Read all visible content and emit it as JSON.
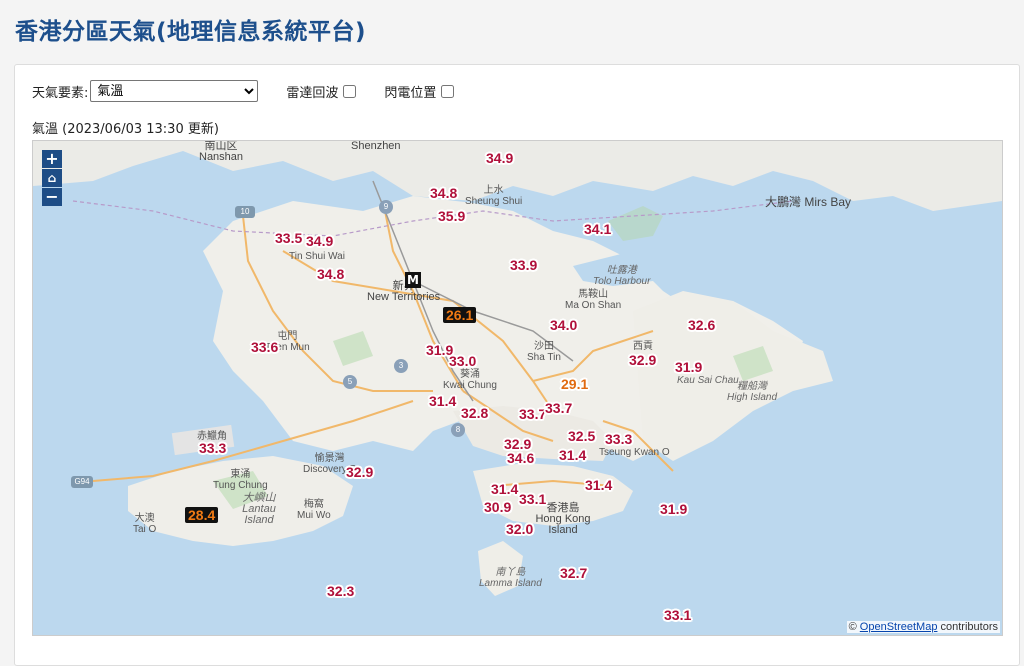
{
  "page": {
    "title": "香港分區天氣(地理信息系統平台)"
  },
  "controls": {
    "element_label": "天氣要素:",
    "element_selected": "氣溫",
    "radar_label": "雷達回波",
    "lightning_label": "閃電位置"
  },
  "update": {
    "text": "氣溫 (2023/06/03 13:30 更新)"
  },
  "map": {
    "zoom_in": "+",
    "zoom_home": "⌂",
    "zoom_out": "−",
    "attribution_prefix": "©",
    "attribution_link": "OpenStreetMap",
    "attribution_suffix": "contributors",
    "mtr_label": "M",
    "places": [
      {
        "id": "nanshan",
        "zh": "南山区",
        "en": "Nanshan"
      },
      {
        "id": "shenzhen",
        "zh": "",
        "en": "Shenzhen"
      },
      {
        "id": "sheungshui",
        "zh": "上水",
        "en": "Sheung Shui"
      },
      {
        "id": "tinshuiwai",
        "zh": "",
        "en": "Tin Shui Wai"
      },
      {
        "id": "newterritories",
        "zh": "新界",
        "en": "New Territories"
      },
      {
        "id": "tunmun",
        "zh": "屯門",
        "en": "Tuen Mun"
      },
      {
        "id": "tolo",
        "zh": "吐露港",
        "en": "Tolo Harbour"
      },
      {
        "id": "maonshan",
        "zh": "馬鞍山",
        "en": "Ma On Shan"
      },
      {
        "id": "shatin",
        "zh": "沙田",
        "en": "Sha Tin"
      },
      {
        "id": "saikung",
        "zh": "西貢",
        "en": ""
      },
      {
        "id": "kaisaichau",
        "zh": "",
        "en": "Kau Sai Chau"
      },
      {
        "id": "highisland",
        "zh": "糧船灣",
        "en": "High Island"
      },
      {
        "id": "kwaichung",
        "zh": "葵涌",
        "en": "Kwai Chung"
      },
      {
        "id": "mirsbay",
        "zh": "大鵬灣",
        "en": "Mirs Bay"
      },
      {
        "id": "chekLapKok",
        "zh": "赤鱲角",
        "en": ""
      },
      {
        "id": "tungchung",
        "zh": "東涌",
        "en": "Tung Chung"
      },
      {
        "id": "discoverybay",
        "zh": "愉景灣",
        "en": "Discovery B"
      },
      {
        "id": "lantau",
        "zh": "大嶼山",
        "en": "Lantau Island"
      },
      {
        "id": "muiwo",
        "zh": "梅窩",
        "en": "Mui Wo"
      },
      {
        "id": "taio",
        "zh": "大澳",
        "en": "Tai O"
      },
      {
        "id": "hongkongisland",
        "zh": "香港島",
        "en": "Hong Kong Island"
      },
      {
        "id": "lamma",
        "zh": "南丫島",
        "en": "Lamma Island"
      },
      {
        "id": "tseungkwano",
        "zh": "",
        "en": "Tseung Kwan O"
      }
    ],
    "road_shields": [
      "9",
      "10",
      "5",
      "3",
      "8",
      "G94"
    ],
    "temperatures": [
      {
        "value": "34.9",
        "style": "normal"
      },
      {
        "value": "34.8",
        "style": "normal"
      },
      {
        "value": "35.9",
        "style": "normal"
      },
      {
        "value": "33.5",
        "style": "normal"
      },
      {
        "value": "34.9",
        "style": "normal"
      },
      {
        "value": "34.8",
        "style": "normal"
      },
      {
        "value": "34.1",
        "style": "normal"
      },
      {
        "value": "33.9",
        "style": "normal"
      },
      {
        "value": "26.1",
        "style": "boxed"
      },
      {
        "value": "34.0",
        "style": "normal"
      },
      {
        "value": "32.6",
        "style": "normal"
      },
      {
        "value": "33.6",
        "style": "normal"
      },
      {
        "value": "31.9",
        "style": "normal"
      },
      {
        "value": "33.0",
        "style": "normal"
      },
      {
        "value": "32.9",
        "style": "normal"
      },
      {
        "value": "31.9",
        "style": "normal"
      },
      {
        "value": "29.1",
        "style": "orange"
      },
      {
        "value": "31.4",
        "style": "normal"
      },
      {
        "value": "32.8",
        "style": "normal"
      },
      {
        "value": "33.7",
        "style": "normal"
      },
      {
        "value": "33.7",
        "style": "normal"
      },
      {
        "value": "33.3",
        "style": "normal"
      },
      {
        "value": "32.5",
        "style": "normal"
      },
      {
        "value": "33.3",
        "style": "normal"
      },
      {
        "value": "32.9",
        "style": "normal"
      },
      {
        "value": "34.6",
        "style": "normal"
      },
      {
        "value": "31.4",
        "style": "normal"
      },
      {
        "value": "32.9",
        "style": "normal"
      },
      {
        "value": "31.4",
        "style": "normal"
      },
      {
        "value": "33.1",
        "style": "normal"
      },
      {
        "value": "31.4",
        "style": "normal"
      },
      {
        "value": "30.9",
        "style": "normal"
      },
      {
        "value": "28.4",
        "style": "boxed"
      },
      {
        "value": "32.0",
        "style": "normal"
      },
      {
        "value": "31.9",
        "style": "normal"
      },
      {
        "value": "32.7",
        "style": "normal"
      },
      {
        "value": "32.3",
        "style": "normal"
      },
      {
        "value": "33.1",
        "style": "normal"
      }
    ]
  }
}
